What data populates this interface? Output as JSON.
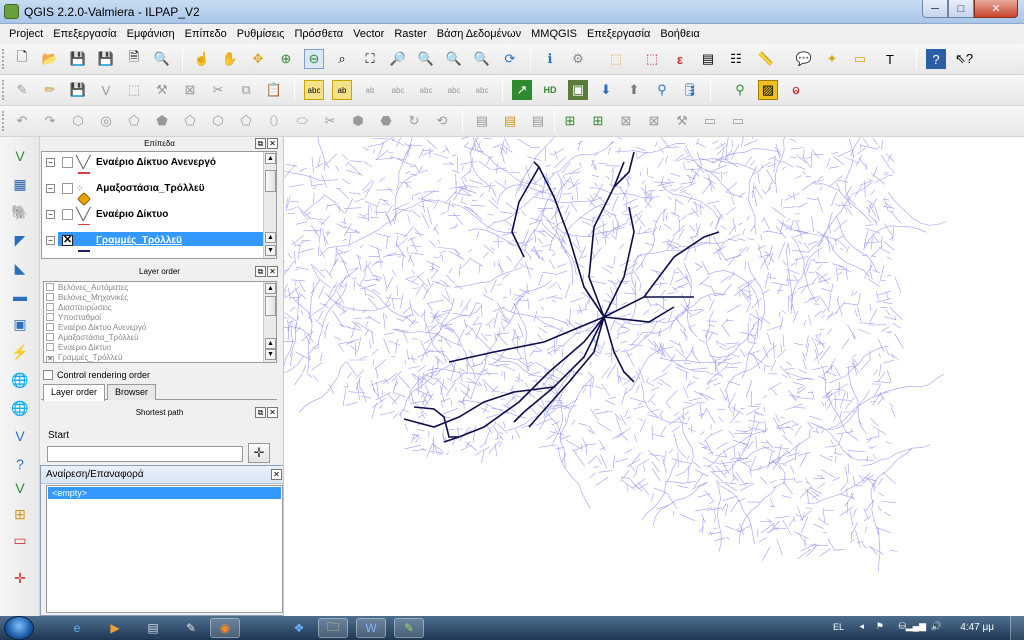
{
  "window": {
    "title": "QGIS 2.2.0-Valmiera - ILPAP_V2",
    "buttons": {
      "minimize": "─",
      "maximize": "□",
      "close": "✕"
    }
  },
  "menu": [
    "Project",
    "Επεξεργασία",
    "Εμφάνιση",
    "Επίπεδο",
    "Ρυθμίσεις",
    "Πρόσθετα",
    "Vector",
    "Raster",
    "Βάση Δεδομένων",
    "MMQGIS",
    "Επεξεργασία",
    "Βοήθεια"
  ],
  "layers_panel": {
    "title": "Επίπεδα",
    "layers": [
      {
        "name": "Εναέριο Δίκτυο Ανενεργό",
        "checked": false,
        "type_icon": "line-layer-icon"
      },
      {
        "name": "Αμαξοστάσια_Τρόλλεϋ",
        "checked": false,
        "type_icon": "point-layer-icon"
      },
      {
        "name": "Εναέριο Δίκτυο",
        "checked": false,
        "type_icon": "line-layer-icon"
      },
      {
        "name": "Γραμμές_Τρόλλεϋ",
        "checked": true,
        "type_icon": "line-layer-icon"
      }
    ]
  },
  "layer_order_panel": {
    "title": "Layer order",
    "items": [
      "Βελόνες_Αυτόματες",
      "Βελόνες_Μηχανικές",
      "Διασταυρώσεις",
      "Υποσταθμοί",
      "Εναέριο Δίκτυο Ανενεργό",
      "Αμαξοστάσια_Τρόλλεϋ",
      "Εναέριο Δίκτυο",
      "Γραμμές_Τρόλλεϋ"
    ],
    "checked": [
      false,
      false,
      false,
      false,
      false,
      false,
      false,
      true
    ],
    "control_rendering_label": "Control rendering order",
    "tabs": [
      "Layer order",
      "Browser"
    ]
  },
  "shortest_path_panel": {
    "title": "Shortest path",
    "start_label": "Start",
    "start_value": ""
  },
  "undo_panel": {
    "title": "Αναίρεση/Επαναφορά",
    "items": [
      "<empty>"
    ]
  },
  "taskbar": {
    "language": "EL",
    "clock": "4:47 μμ",
    "apps": [
      "ie-icon",
      "media-player-icon",
      "file-explorer-icon",
      "paint-icon",
      "firefox-icon",
      "dropbox-icon",
      "folder-icon",
      "word-icon",
      "qgis-icon"
    ]
  },
  "colors": {
    "network": "#8c8cf0",
    "trolley_lines": "#0d0d4a",
    "selection": "#3399ff"
  }
}
